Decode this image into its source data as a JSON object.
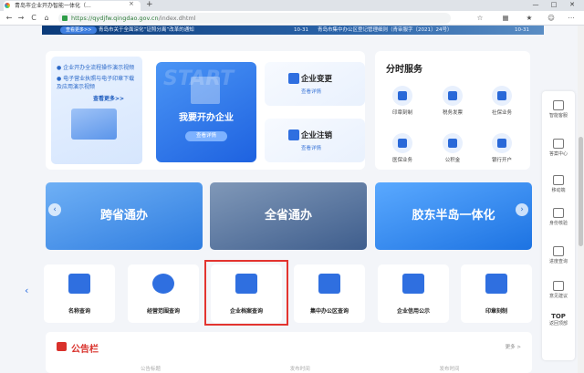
{
  "browser": {
    "tab_title": "青岛市企业开办智能一体化（...",
    "tab_close": "×",
    "new_tab": "+",
    "url_host": "https://qydjfw.qingdao.gov.cn",
    "url_path": "/index.dhtml",
    "controls": {
      "min": "—",
      "max": "□",
      "close": "✕"
    },
    "nav": {
      "back": "←",
      "forward": "→",
      "reload": "C",
      "home": "⌂"
    }
  },
  "news": {
    "more": "查看更多>>",
    "items": [
      {
        "text": "青岛市关于全面深化“证照分离”改革的通知",
        "date": "10-31"
      },
      {
        "text": "青岛市集中办公区登记管理细则（青审服字〔2021〕24号）",
        "date": "10-31"
      }
    ]
  },
  "guide": {
    "items": [
      "企业开办全流程操作演示视频",
      "电子营业执照与电子印章下载及应用演示视频"
    ],
    "see_more": "查看更多>>"
  },
  "start": {
    "bg_word": "START",
    "title": "我要开办企业",
    "button": "查看详情"
  },
  "change": {
    "title": "企业变更",
    "link": "查看详情"
  },
  "cancel": {
    "title": "企业注销",
    "link": "查看详情"
  },
  "services": {
    "title": "分时服务",
    "items": [
      "印章刻制",
      "税务发票",
      "社保业务",
      "医保业务",
      "公积金",
      "银行开户"
    ]
  },
  "banners": [
    {
      "label": "跨省通办"
    },
    {
      "label": "全省通办"
    },
    {
      "label": "胶东半岛一体化"
    }
  ],
  "banner_arrows": {
    "left": "‹",
    "right": "›"
  },
  "quick": {
    "prev": "‹",
    "items": [
      "名称查询",
      "经营范围查询",
      "企业档案查询",
      "集中办公区查询",
      "企业信用公示",
      "印章刻制"
    ]
  },
  "notice": {
    "title": "公告栏",
    "more": "更多 >",
    "columns": [
      "公告标题",
      "发布时间",
      "发布时间"
    ]
  },
  "sidebar": {
    "items": [
      "智能客服",
      "答案中心",
      "移动端",
      "身份核验",
      "进度查询",
      "意见建议"
    ],
    "top": "TOP",
    "top_label": "返回顶部"
  }
}
